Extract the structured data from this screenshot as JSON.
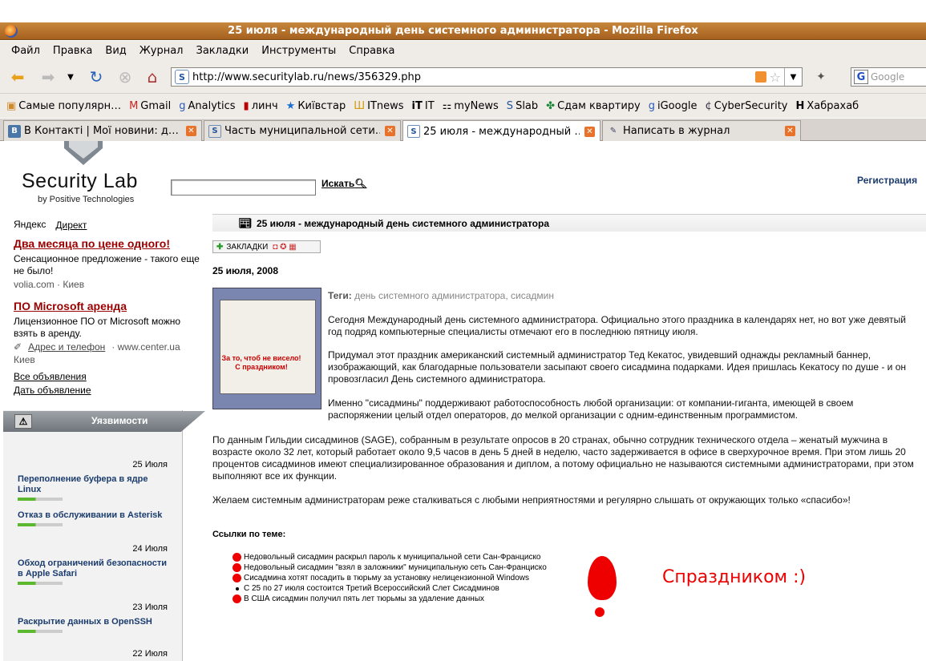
{
  "window": {
    "title": "25 июля - международный день системного администратора - Mozilla Firefox"
  },
  "menu": [
    "Файл",
    "Правка",
    "Вид",
    "Журнал",
    "Закладки",
    "Инструменты",
    "Справка"
  ],
  "nav": {
    "url": "http://www.securitylab.ru/news/356329.php",
    "search_placeholder": "Google"
  },
  "bookmarks": [
    {
      "icon": "folder-icon",
      "label": "Самые популярн…"
    },
    {
      "icon": "gmail-icon",
      "label": "Gmail"
    },
    {
      "icon": "google-icon",
      "label": "Analytics"
    },
    {
      "icon": "linch-icon",
      "label": "линч"
    },
    {
      "icon": "star-icon",
      "label": "Київстар"
    },
    {
      "icon": "itnews-icon",
      "label": "ITnews"
    },
    {
      "icon": "it-icon",
      "label": "IT"
    },
    {
      "icon": "mynews-icon",
      "label": "myNews"
    },
    {
      "icon": "slab-icon",
      "label": "Slab"
    },
    {
      "icon": "apartment-icon",
      "label": "Сдам квартиру"
    },
    {
      "icon": "google-icon",
      "label": "iGoogle"
    },
    {
      "icon": "cybersecurity-icon",
      "label": "CyberSecurity"
    },
    {
      "icon": "habr-icon",
      "label": "Хабрахаб"
    }
  ],
  "tabs": [
    {
      "label": "В Контакті | Мої новини: д…"
    },
    {
      "label": "Часть муниципальной сети…"
    },
    {
      "label": "25 июля - международный …"
    },
    {
      "label": "Написать в журнал"
    }
  ],
  "site": {
    "logo": "Security Lab",
    "logo_sub": "by Positive Technologies",
    "search_button": "Искать",
    "register": "Регистрация"
  },
  "ads": {
    "yandex": "Яндекс",
    "direct": "Директ",
    "ad1": {
      "title": "Два месяца по цене одного!",
      "text": "Сенсационное предложение - такого еще не было!",
      "source": "volia.com   ·   Киев"
    },
    "ad2": {
      "title": "ПО Microsoft аренда",
      "text": "Лицензионное ПО от Microsoft можно взять в аренду.",
      "address": "Адрес и телефон",
      "source": "·   www.center.ua",
      "city": "Киев"
    },
    "all": "Все объявления",
    "give": "Дать объявление"
  },
  "vulns": {
    "title": "Уязвимости",
    "items": [
      {
        "date": "25 Июля",
        "title": "Переполнение буфера в ядре Linux"
      },
      {
        "date": "",
        "title": "Отказ в обслуживании в Asterisk"
      },
      {
        "date": "24 Июля",
        "title": "Обход ограничений безопасности в Apple Safari"
      },
      {
        "date": "23 Июля",
        "title": "Раскрытие данных в OpenSSH"
      },
      {
        "date": "22 Июля",
        "title": ""
      }
    ]
  },
  "article": {
    "headline": "25 июля - международный день системного администратора",
    "bookmarks_btn": "ЗАКЛАДКИ",
    "date": "25 июля, 2008",
    "tags_label": "Теги:",
    "tags": "день системного администратора, сисадмин",
    "thumb_text": "За то, чтоб не висело! С праздником!",
    "p1": "Сегодня Международный день системного администратора. Официально этого праздника в календарях нет, но вот уже девятый год подряд компьютерные специалисты отмечают его в последнюю пятницу июля.",
    "p2": "Придумал этот праздник американский системный администратор Тед Кекатос, увидевший однажды рекламный баннер, изображающий, как благодарные пользователи засыпают своего сисадмина подарками. Идея пришлась Кекатосу по душе - и он провозгласил День системного администратора.",
    "p3": "Именно \"сисадмины\" поддерживают работоспособность любой организации: от компании-гиганта, имеющей в своем распоряжении целый отдел операторов, до мелкой организации с одним-единственным программистом.",
    "p4": "По данным Гильдии сисадминов (SAGE), собранным в результате опросов в 20 странах, обычно сотрудник технического отдела – женатый мужчина в возрасте около 32 лет, который работает около 9,5 часов в день 5 дней в неделю, часто задерживается в офисе в сверхурочное время. При этом лишь 20 процентов сисадминов имеют специализированное образования и диплом, а потому официально не называются системными администраторами, при этом выполняют все их функции.",
    "p5": "Желаем системным администраторам реже сталкиваться с любыми неприятностями и регулярно слышать от окружающих только «спасибо»!",
    "links_title": "Ссылки по теме:",
    "links": [
      "Недовольный сисадмин раскрыл пароль к муниципальной сети Сан-Франциско",
      "Недовольный сисадмин \"взял в заложники\" муниципальную сеть Сан-Франциско",
      "Сисадмина хотят посадить в тюрьму за установку нелицензионной Windows",
      "С 25 по 27 июля состоится Третий Всероссийский Слет Сисадминов",
      "В США сисадмин получил пять лет тюрьмы за удаление данных"
    ],
    "congrats": "Спраздником :)"
  }
}
